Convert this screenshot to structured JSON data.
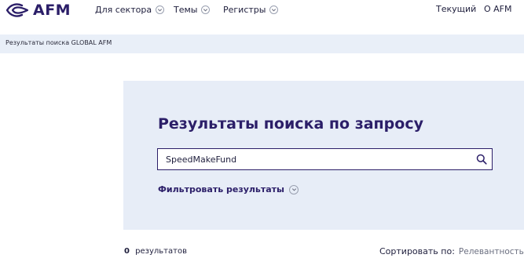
{
  "header": {
    "logo_text": "AFM",
    "nav": [
      {
        "label": "Для сектора"
      },
      {
        "label": "Темы"
      },
      {
        "label": "Регистры"
      }
    ],
    "right_links": [
      {
        "label": "Текущий"
      },
      {
        "label": "О AFM"
      }
    ]
  },
  "breadcrumb": {
    "text": "Результаты поиска GLOBAL AFM"
  },
  "search": {
    "title": "Результаты поиска по запросу",
    "value": "SpeedMakeFund",
    "filter_label": "Фильтровать результаты"
  },
  "results": {
    "count": "0",
    "count_label": "результатов",
    "sort_label": "Сортировать по:",
    "sort_value": "Релевантность"
  },
  "colors": {
    "brand": "#2b1e68",
    "panel_bg": "#e7edf7",
    "breadcrumb_bg": "#e9eff8"
  }
}
